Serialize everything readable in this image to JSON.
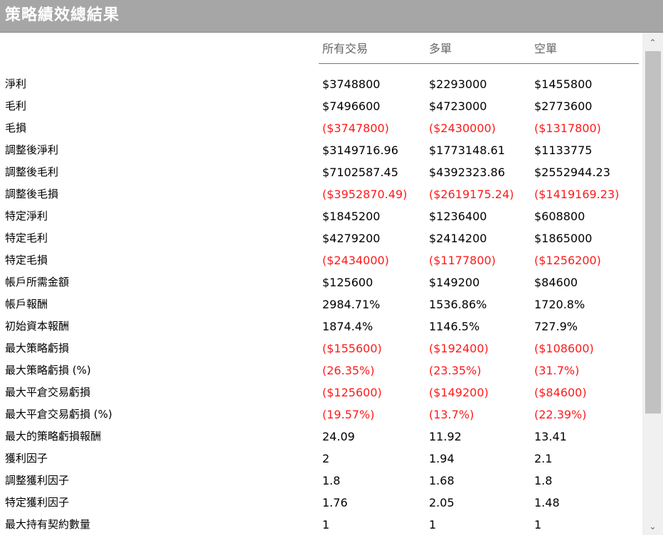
{
  "title": "策略績效總結果",
  "columns": [
    "所有交易",
    "多單",
    "空單"
  ],
  "colors": {
    "negative": "#ff1a1a",
    "titlebar": "#a6a6a6"
  },
  "rows": [
    {
      "label": "淨利",
      "values": [
        "$3748800",
        "$2293000",
        "$1455800"
      ],
      "negative": false
    },
    {
      "label": "毛利",
      "values": [
        "$7496600",
        "$4723000",
        "$2773600"
      ],
      "negative": false
    },
    {
      "label": "毛損",
      "values": [
        "($3747800)",
        "($2430000)",
        "($1317800)"
      ],
      "negative": true
    },
    {
      "label": "調整後淨利",
      "values": [
        "$3149716.96",
        "$1773148.61",
        "$1133775"
      ],
      "negative": false
    },
    {
      "label": "調整後毛利",
      "values": [
        "$7102587.45",
        "$4392323.86",
        "$2552944.23"
      ],
      "negative": false
    },
    {
      "label": "調整後毛損",
      "values": [
        "($3952870.49)",
        "($2619175.24)",
        "($1419169.23)"
      ],
      "negative": true
    },
    {
      "label": "特定淨利",
      "values": [
        "$1845200",
        "$1236400",
        "$608800"
      ],
      "negative": false
    },
    {
      "label": "特定毛利",
      "values": [
        "$4279200",
        "$2414200",
        "$1865000"
      ],
      "negative": false
    },
    {
      "label": "特定毛損",
      "values": [
        "($2434000)",
        "($1177800)",
        "($1256200)"
      ],
      "negative": true
    },
    {
      "label": "帳戶所需金額",
      "values": [
        "$125600",
        "$149200",
        "$84600"
      ],
      "negative": false
    },
    {
      "label": "帳戶報酬",
      "values": [
        "2984.71%",
        "1536.86%",
        "1720.8%"
      ],
      "negative": false
    },
    {
      "label": "初始資本報酬",
      "values": [
        "1874.4%",
        "1146.5%",
        "727.9%"
      ],
      "negative": false
    },
    {
      "label": "最大策略虧損",
      "values": [
        "($155600)",
        "($192400)",
        "($108600)"
      ],
      "negative": true
    },
    {
      "label": "最大策略虧損 (%)",
      "values": [
        "(26.35%)",
        "(23.35%)",
        "(31.7%)"
      ],
      "negative": true
    },
    {
      "label": "最大平倉交易虧損",
      "values": [
        "($125600)",
        "($149200)",
        "($84600)"
      ],
      "negative": true
    },
    {
      "label": "最大平倉交易虧損 (%)",
      "values": [
        "(19.57%)",
        "(13.7%)",
        "(22.39%)"
      ],
      "negative": true
    },
    {
      "label": "最大的策略虧損報酬",
      "values": [
        "24.09",
        "11.92",
        "13.41"
      ],
      "negative": false
    },
    {
      "label": "獲利因子",
      "values": [
        "2",
        "1.94",
        "2.1"
      ],
      "negative": false
    },
    {
      "label": "調整獲利因子",
      "values": [
        "1.8",
        "1.68",
        "1.8"
      ],
      "negative": false
    },
    {
      "label": "特定獲利因子",
      "values": [
        "1.76",
        "2.05",
        "1.48"
      ],
      "negative": false
    },
    {
      "label": "最大持有契約數量",
      "values": [
        "1",
        "1",
        "1"
      ],
      "negative": false
    }
  ],
  "scrollbar": {
    "up_icon": "chevron-up-icon",
    "down_icon": "chevron-down-icon",
    "up_glyph": "⌃",
    "down_glyph": "⌄"
  }
}
